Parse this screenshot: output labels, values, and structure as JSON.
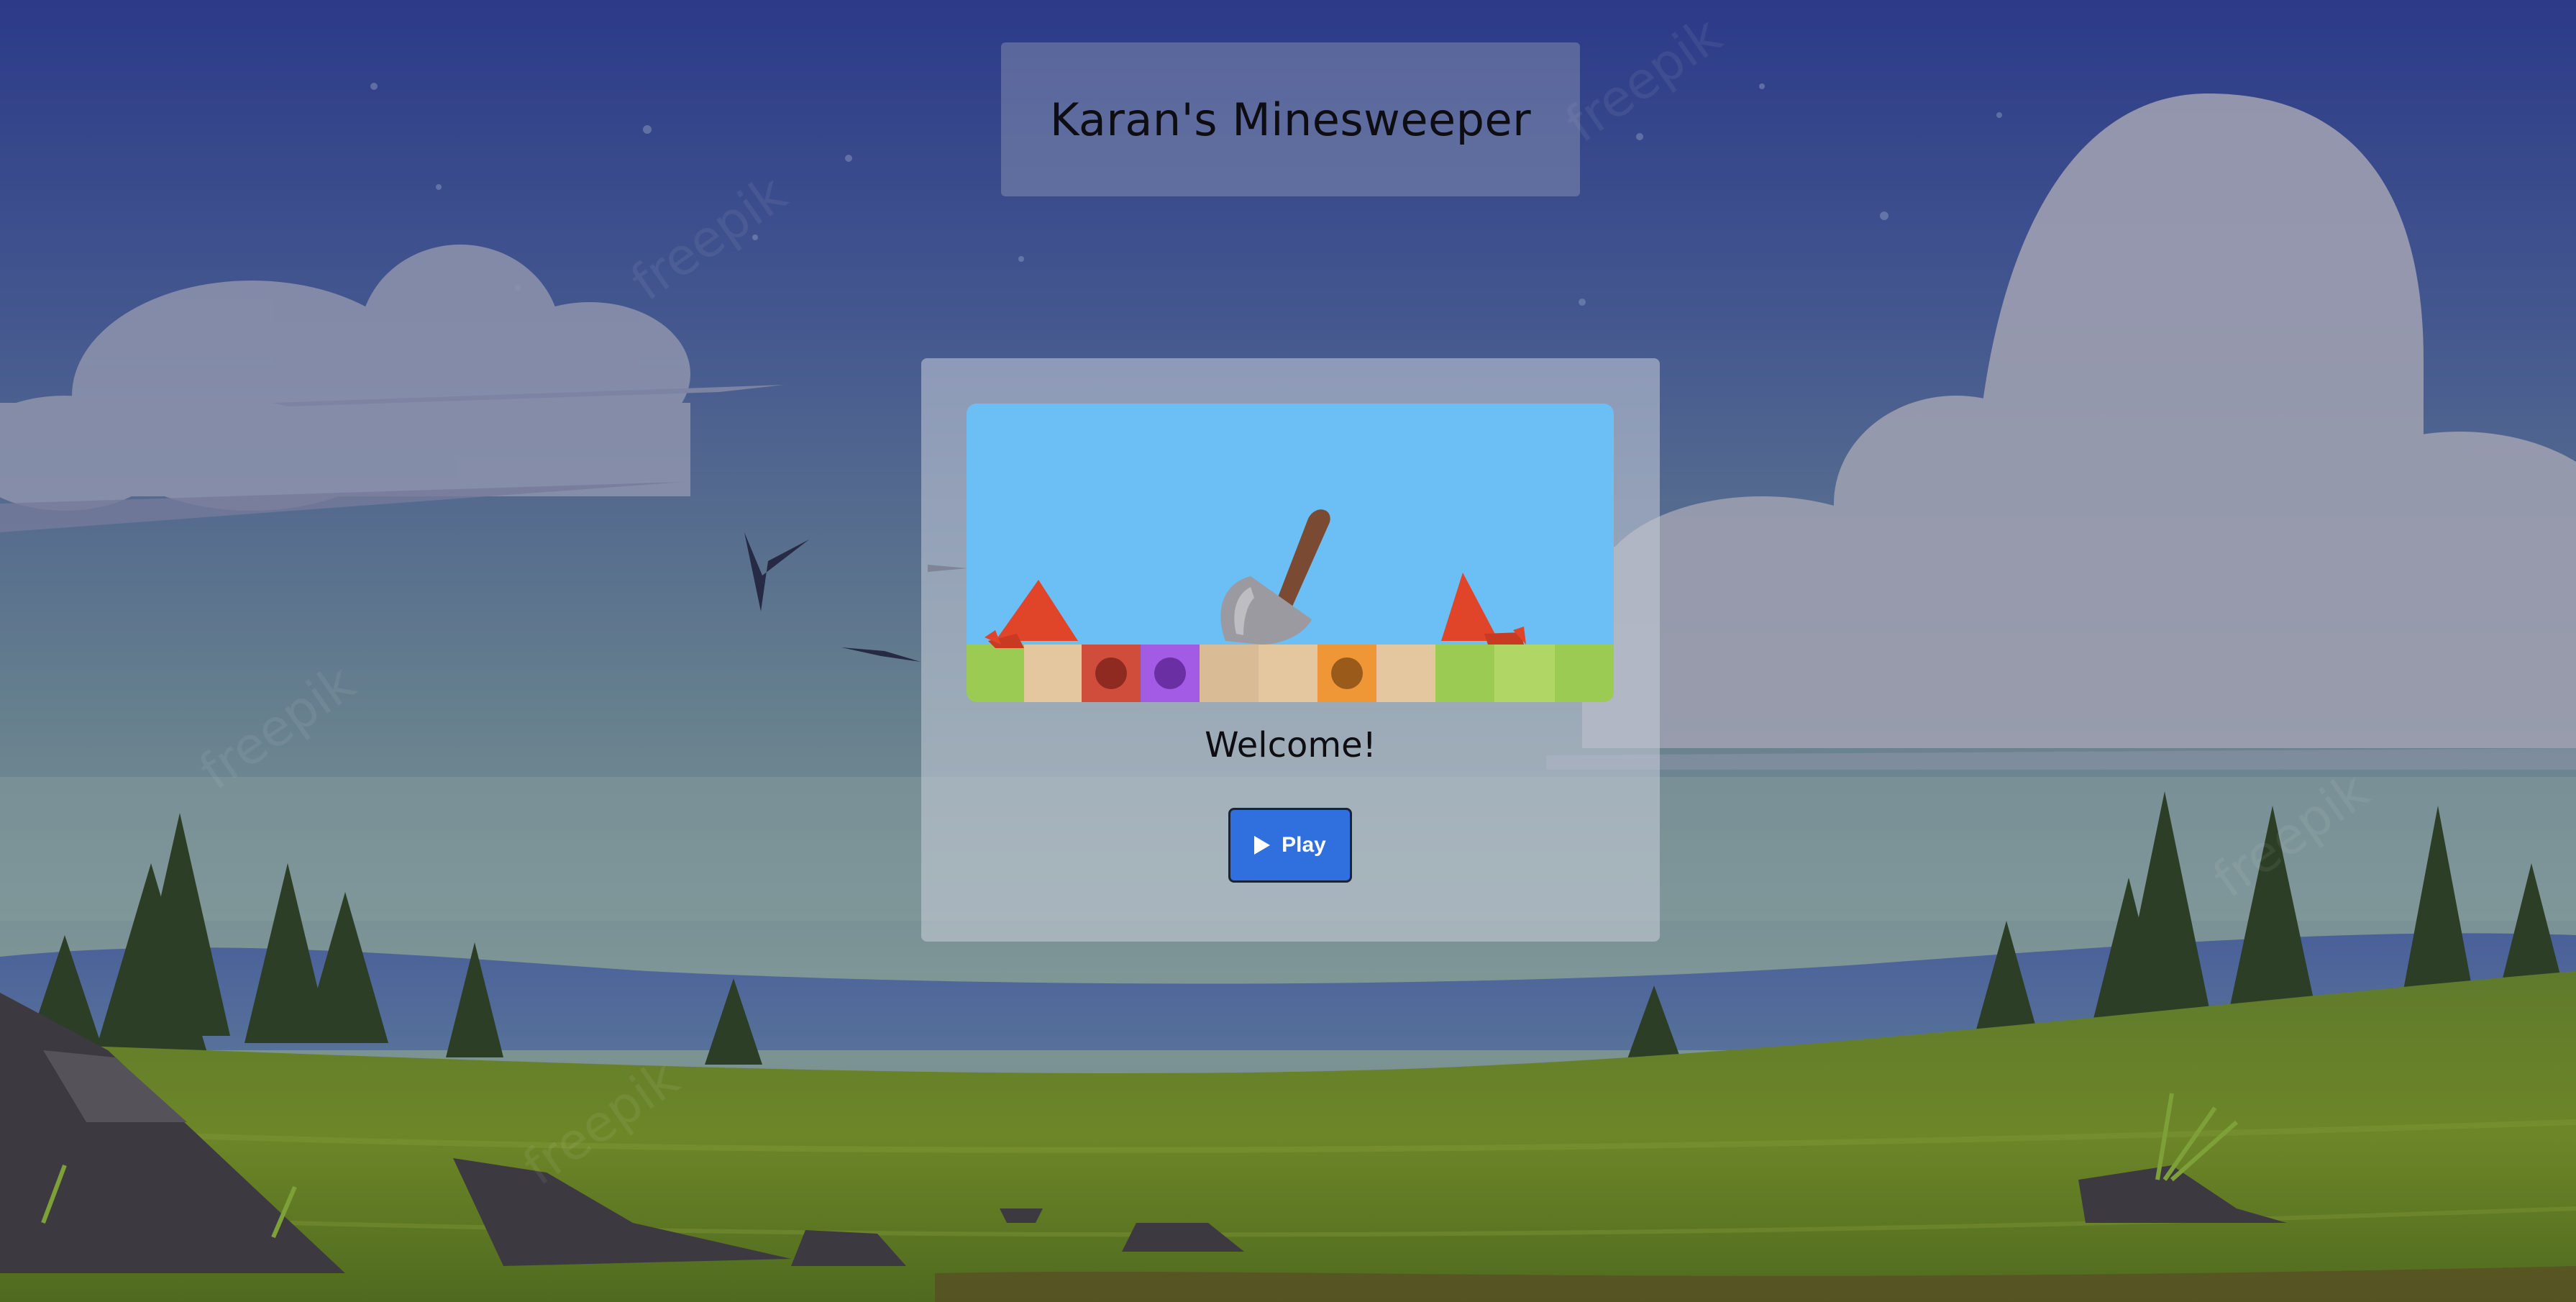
{
  "header": {
    "title": "Karan's Minesweeper"
  },
  "main": {
    "welcome_text": "Welcome!",
    "play_button": {
      "label": "Play",
      "icon": "play-icon"
    }
  },
  "colors": {
    "sky_top": "#2f3e86",
    "button": "#2f6fde",
    "hero_sky": "#6bbff5",
    "hero_grass": "#9ccb53"
  },
  "background": {
    "watermark": "freepik"
  }
}
